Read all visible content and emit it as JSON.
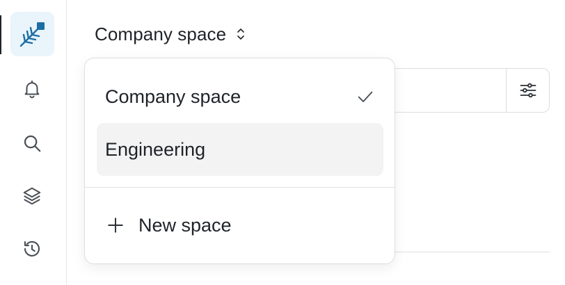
{
  "sidebar": {
    "items": [
      {
        "name": "home",
        "icon": "feather-logo-icon",
        "active": true
      },
      {
        "name": "notifications",
        "icon": "bell-icon"
      },
      {
        "name": "search",
        "icon": "search-icon"
      },
      {
        "name": "layers",
        "icon": "layers-icon"
      },
      {
        "name": "history",
        "icon": "history-icon"
      }
    ]
  },
  "header": {
    "space_label": "Company space",
    "selector_icon": "chevron-up-down-icon"
  },
  "filter": {
    "icon": "sliders-icon"
  },
  "dropdown": {
    "items": [
      {
        "label": "Company space",
        "selected": true,
        "icon": "check-icon"
      },
      {
        "label": "Engineering",
        "selected": false,
        "hovered": true
      }
    ],
    "new_space_label": "New space",
    "new_space_icon": "plus-icon"
  },
  "colors": {
    "accent": "#1c6ea4",
    "logo_bg": "#e9f4fb",
    "hover_bg": "#f3f3f3",
    "text": "#1f2328"
  }
}
